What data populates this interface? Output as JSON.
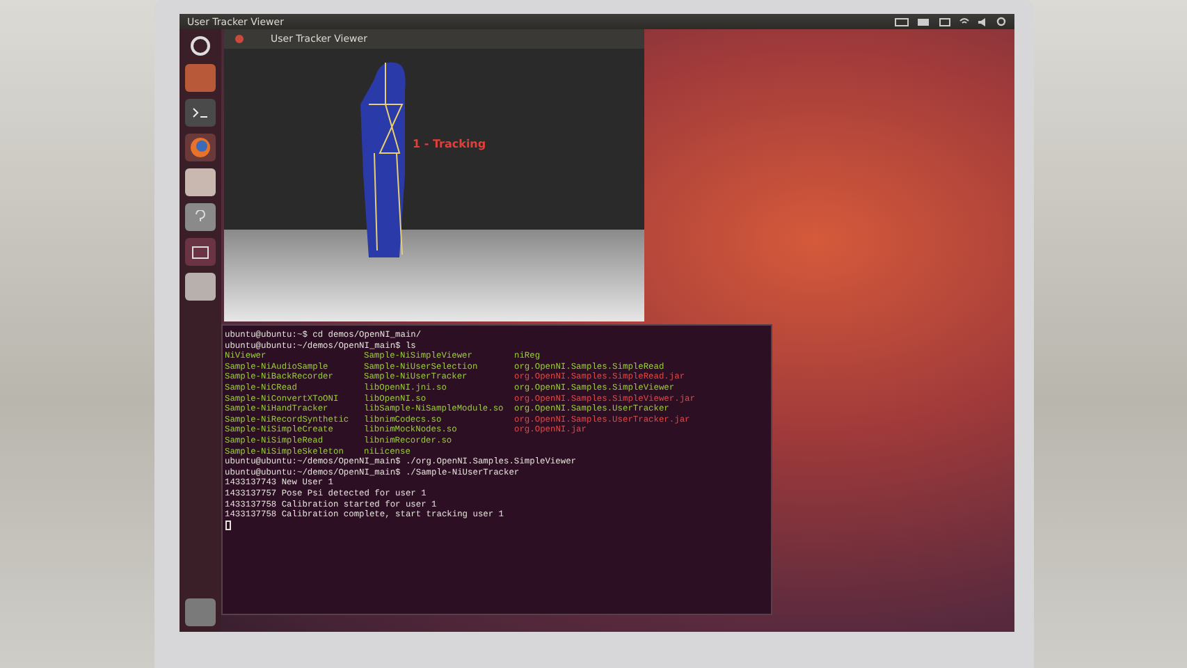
{
  "top_panel": {
    "title": "User Tracker Viewer"
  },
  "viewer_window": {
    "title": "User Tracker Viewer",
    "user_label": "1 - Tracking"
  },
  "terminal": {
    "lines": [
      {
        "kind": "text",
        "text": "ubuntu@ubuntu:~$ cd demos/OpenNI_main/"
      },
      {
        "kind": "text",
        "text": "ubuntu@ubuntu:~/demos/OpenNI_main$ ls"
      },
      {
        "kind": "columns",
        "cells": [
          {
            "text": "NiViewer",
            "kind": "exec"
          },
          {
            "text": "Sample-NiSimpleViewer",
            "kind": "exec"
          },
          {
            "text": "niReg",
            "kind": "exec"
          }
        ]
      },
      {
        "kind": "columns",
        "cells": [
          {
            "text": "Sample-NiAudioSample",
            "kind": "exec"
          },
          {
            "text": "Sample-NiUserSelection",
            "kind": "exec"
          },
          {
            "text": "org.OpenNI.Samples.SimpleRead",
            "kind": "exec"
          }
        ]
      },
      {
        "kind": "columns",
        "cells": [
          {
            "text": "Sample-NiBackRecorder",
            "kind": "exec"
          },
          {
            "text": "Sample-NiUserTracker",
            "kind": "exec"
          },
          {
            "text": "org.OpenNI.Samples.SimpleRead.jar",
            "kind": "archive"
          }
        ]
      },
      {
        "kind": "columns",
        "cells": [
          {
            "text": "Sample-NiCRead",
            "kind": "exec"
          },
          {
            "text": "libOpenNI.jni.so",
            "kind": "exec"
          },
          {
            "text": "org.OpenNI.Samples.SimpleViewer",
            "kind": "exec"
          }
        ]
      },
      {
        "kind": "columns",
        "cells": [
          {
            "text": "Sample-NiConvertXToONI",
            "kind": "exec"
          },
          {
            "text": "libOpenNI.so",
            "kind": "exec"
          },
          {
            "text": "org.OpenNI.Samples.SimpleViewer.jar",
            "kind": "archive"
          }
        ]
      },
      {
        "kind": "columns",
        "cells": [
          {
            "text": "Sample-NiHandTracker",
            "kind": "exec"
          },
          {
            "text": "libSample-NiSampleModule.so",
            "kind": "exec"
          },
          {
            "text": "org.OpenNI.Samples.UserTracker",
            "kind": "exec"
          }
        ]
      },
      {
        "kind": "columns",
        "cells": [
          {
            "text": "Sample-NiRecordSynthetic",
            "kind": "exec"
          },
          {
            "text": "libnimCodecs.so",
            "kind": "exec"
          },
          {
            "text": "org.OpenNI.Samples.UserTracker.jar",
            "kind": "archive"
          }
        ]
      },
      {
        "kind": "columns",
        "cells": [
          {
            "text": "Sample-NiSimpleCreate",
            "kind": "exec"
          },
          {
            "text": "libnimMockNodes.so",
            "kind": "exec"
          },
          {
            "text": "org.OpenNI.jar",
            "kind": "archive"
          }
        ]
      },
      {
        "kind": "columns",
        "cells": [
          {
            "text": "Sample-NiSimpleRead",
            "kind": "exec"
          },
          {
            "text": "libnimRecorder.so",
            "kind": "exec"
          }
        ]
      },
      {
        "kind": "columns",
        "cells": [
          {
            "text": "Sample-NiSimpleSkeleton",
            "kind": "exec"
          },
          {
            "text": "niLicense",
            "kind": "exec"
          }
        ]
      },
      {
        "kind": "text",
        "text": "ubuntu@ubuntu:~/demos/OpenNI_main$ ./org.OpenNI.Samples.SimpleViewer"
      },
      {
        "kind": "text",
        "text": "ubuntu@ubuntu:~/demos/OpenNI_main$ ./Sample-NiUserTracker"
      },
      {
        "kind": "text",
        "text": "1433137743 New User 1"
      },
      {
        "kind": "text",
        "text": "1433137757 Pose Psi detected for user 1"
      },
      {
        "kind": "text",
        "text": "1433137758 Calibration started for user 1"
      },
      {
        "kind": "text",
        "text": "1433137758 Calibration complete, start tracking user 1"
      }
    ]
  }
}
